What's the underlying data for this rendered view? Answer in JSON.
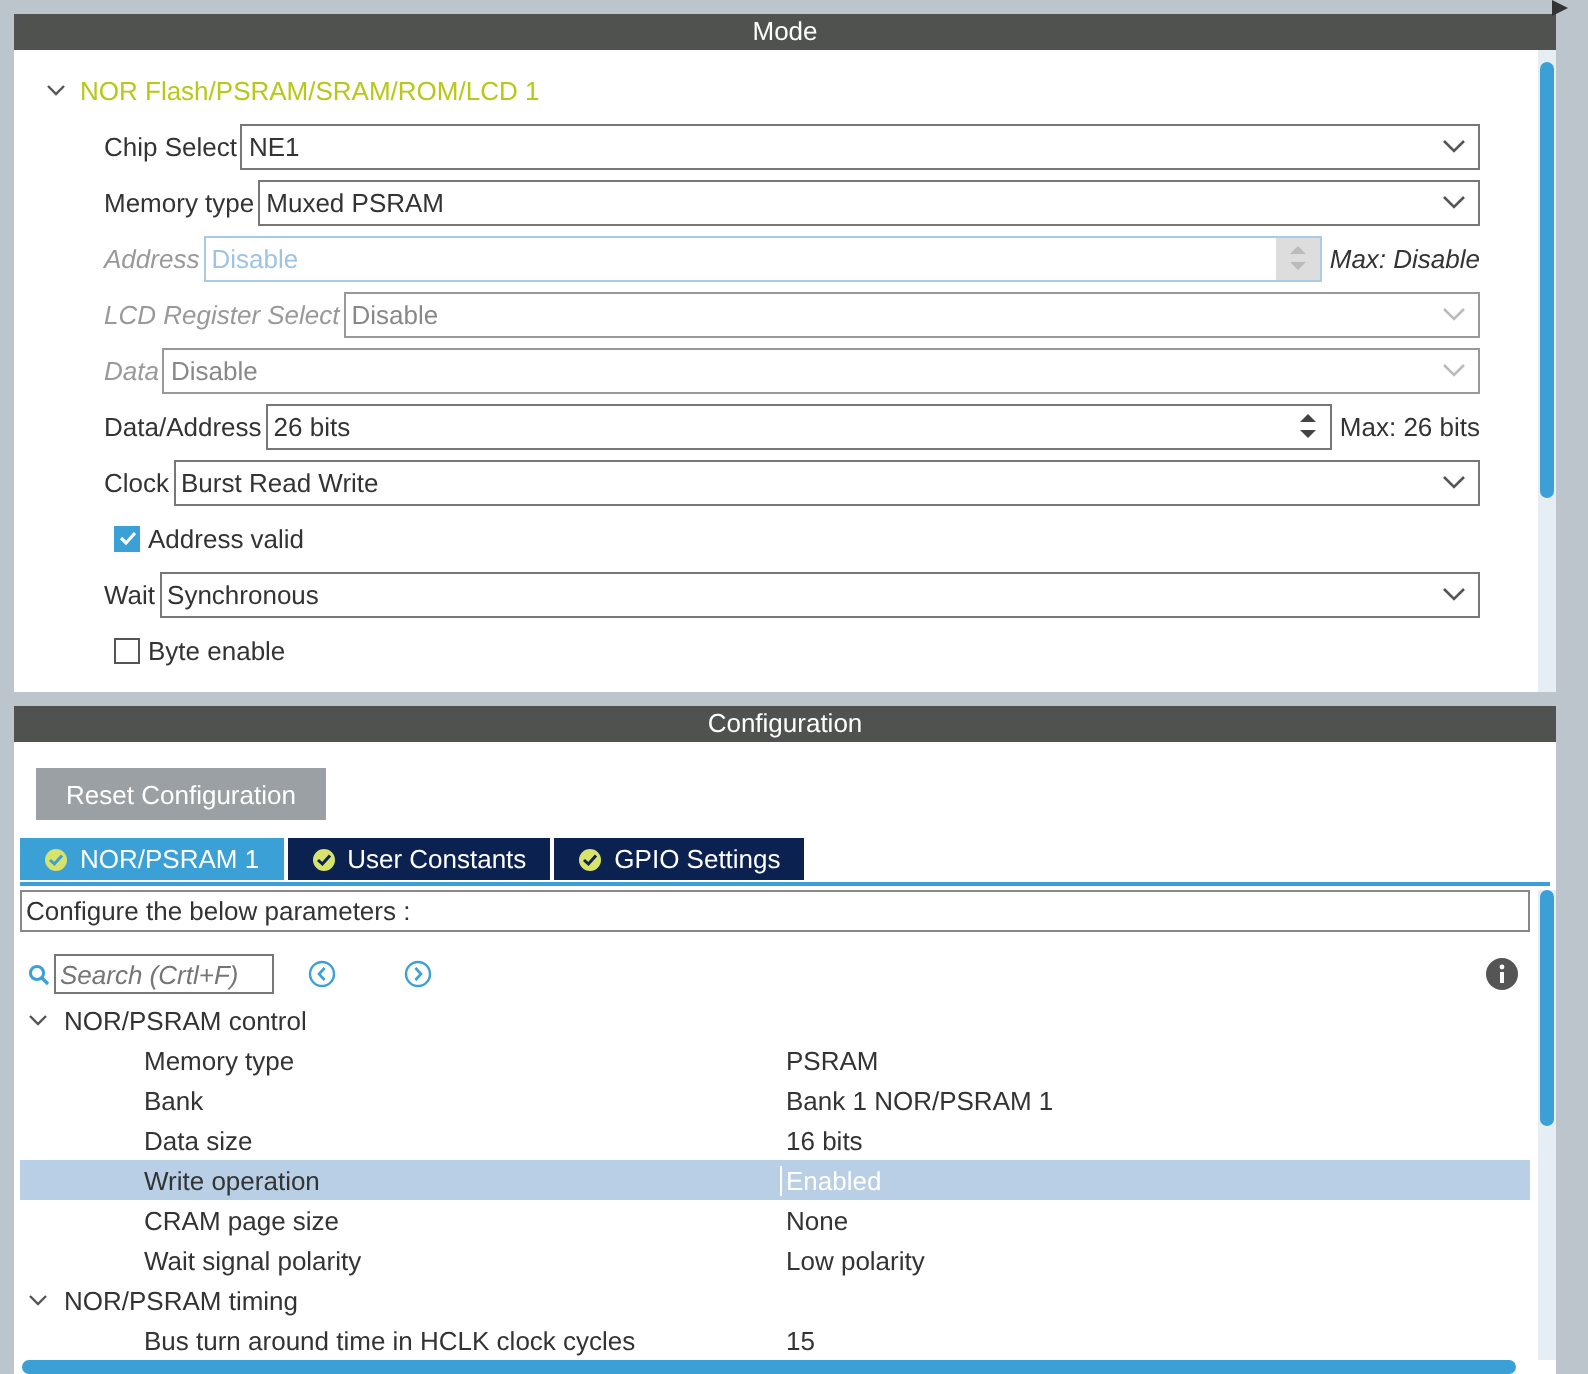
{
  "mode": {
    "title": "Mode",
    "section": {
      "label": "NOR Flash/PSRAM/SRAM/ROM/LCD 1",
      "expanded": true
    },
    "fields": [
      {
        "kind": "select",
        "label": "Chip Select",
        "value": "NE1",
        "disabled": false
      },
      {
        "kind": "select",
        "label": "Memory type",
        "value": "Muxed PSRAM",
        "disabled": false
      },
      {
        "kind": "spin",
        "label": "Address",
        "value": "Disable",
        "disabled": true,
        "max": "Max: Disable"
      },
      {
        "kind": "select",
        "label": "LCD Register Select",
        "value": "Disable",
        "disabled": true
      },
      {
        "kind": "select",
        "label": "Data",
        "value": "Disable",
        "disabled": true
      },
      {
        "kind": "spin",
        "label": "Data/Address",
        "value": "26 bits",
        "disabled": false,
        "max": "Max: 26 bits"
      },
      {
        "kind": "select",
        "label": "Clock",
        "value": "Burst Read Write",
        "disabled": false
      },
      {
        "kind": "checkbox",
        "label": "Address valid",
        "checked": true
      },
      {
        "kind": "select",
        "label": "Wait",
        "value": "Synchronous",
        "disabled": false
      },
      {
        "kind": "checkbox",
        "label": "Byte enable",
        "checked": false
      }
    ]
  },
  "configuration": {
    "title": "Configuration",
    "reset_button": "Reset Configuration",
    "tabs": [
      {
        "label": "NOR/PSRAM 1",
        "selected": true
      },
      {
        "label": "User Constants",
        "selected": false
      },
      {
        "label": "GPIO Settings",
        "selected": false
      }
    ],
    "description": "Configure the below parameters :",
    "search": {
      "placeholder": "Search (Crtl+F)"
    },
    "groups": [
      {
        "label": "NOR/PSRAM control",
        "expanded": true,
        "rows": [
          {
            "name": "Memory type",
            "value": "PSRAM",
            "selected": false
          },
          {
            "name": "Bank",
            "value": "Bank 1 NOR/PSRAM 1",
            "selected": false
          },
          {
            "name": "Data size",
            "value": "16 bits",
            "selected": false
          },
          {
            "name": "Write operation",
            "value": "Enabled",
            "selected": true
          },
          {
            "name": "CRAM page size",
            "value": "None",
            "selected": false
          },
          {
            "name": "Wait signal polarity",
            "value": "Low polarity",
            "selected": false
          }
        ]
      },
      {
        "label": "NOR/PSRAM timing",
        "expanded": true,
        "rows": [
          {
            "name": "Bus turn around time in HCLK clock cycles",
            "value": "15",
            "selected": false
          }
        ]
      }
    ]
  }
}
